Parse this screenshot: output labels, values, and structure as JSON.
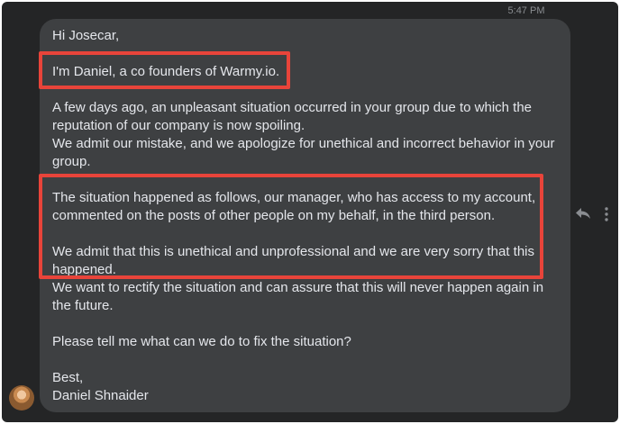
{
  "conversation": {
    "timestamp": "5:47 PM"
  },
  "message": {
    "lines": [
      "Hi Josecar,",
      "I'm Daniel, a co founders of Warmy.io.",
      "A few days ago, an unpleasant situation occurred in your group due to which the",
      "reputation of our company is now spoiling.",
      "We admit our mistake, and we apologize for unethical and incorrect behavior in your",
      "group.",
      "The situation happened as follows, our manager, who has access to my account,",
      "commented on the posts of other people on my behalf, in the third person.",
      "We admit that this is unethical and unprofessional and we are very sorry that this",
      "happened.",
      "We want to rectify the situation and can assure that this will never happen again in",
      "the future.",
      "Please tell me what can we do to fix the situation?",
      "Best,",
      "Daniel Shnaider"
    ]
  },
  "colors": {
    "background": "#242526",
    "bubble": "#3e4042",
    "text": "#e4e6eb",
    "highlight": "#e8443a",
    "muted": "#8a8d91"
  },
  "icons": {
    "reply": "reply-icon",
    "more": "more-options-icon"
  }
}
